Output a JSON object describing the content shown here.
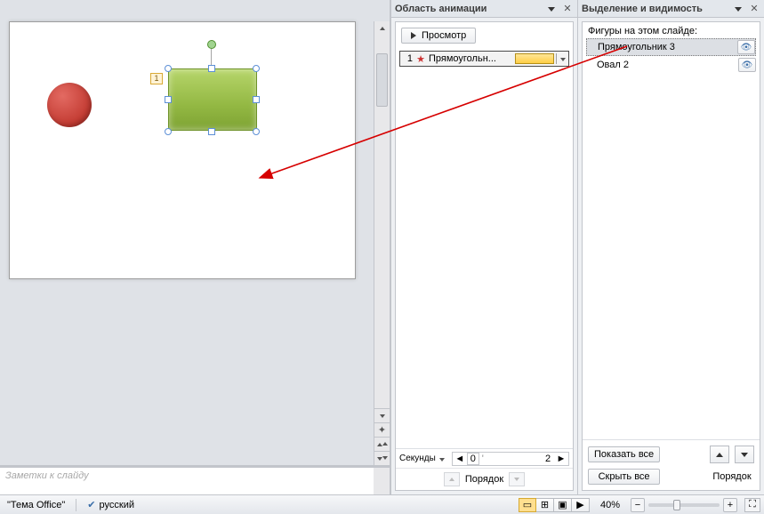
{
  "animation_pane": {
    "title": "Область анимации",
    "preview_label": "Просмотр",
    "item": {
      "index": "1",
      "name": "Прямоугольн..."
    },
    "timeline": {
      "label": "Секунды",
      "zero": "0",
      "two": "2"
    },
    "order_label": "Порядок"
  },
  "selection_pane": {
    "title": "Выделение и видимость",
    "heading": "Фигуры на этом слайде:",
    "items": [
      {
        "name": "Прямоугольник 3",
        "selected": true
      },
      {
        "name": "Овал 2",
        "selected": false
      }
    ],
    "show_all": "Показать все",
    "hide_all": "Скрыть все",
    "order_label": "Порядок"
  },
  "slide": {
    "tag": "1"
  },
  "notes": {
    "placeholder": "Заметки к слайду"
  },
  "status": {
    "theme": "\"Тема Office\"",
    "lang": "русский",
    "zoom": "40%"
  }
}
